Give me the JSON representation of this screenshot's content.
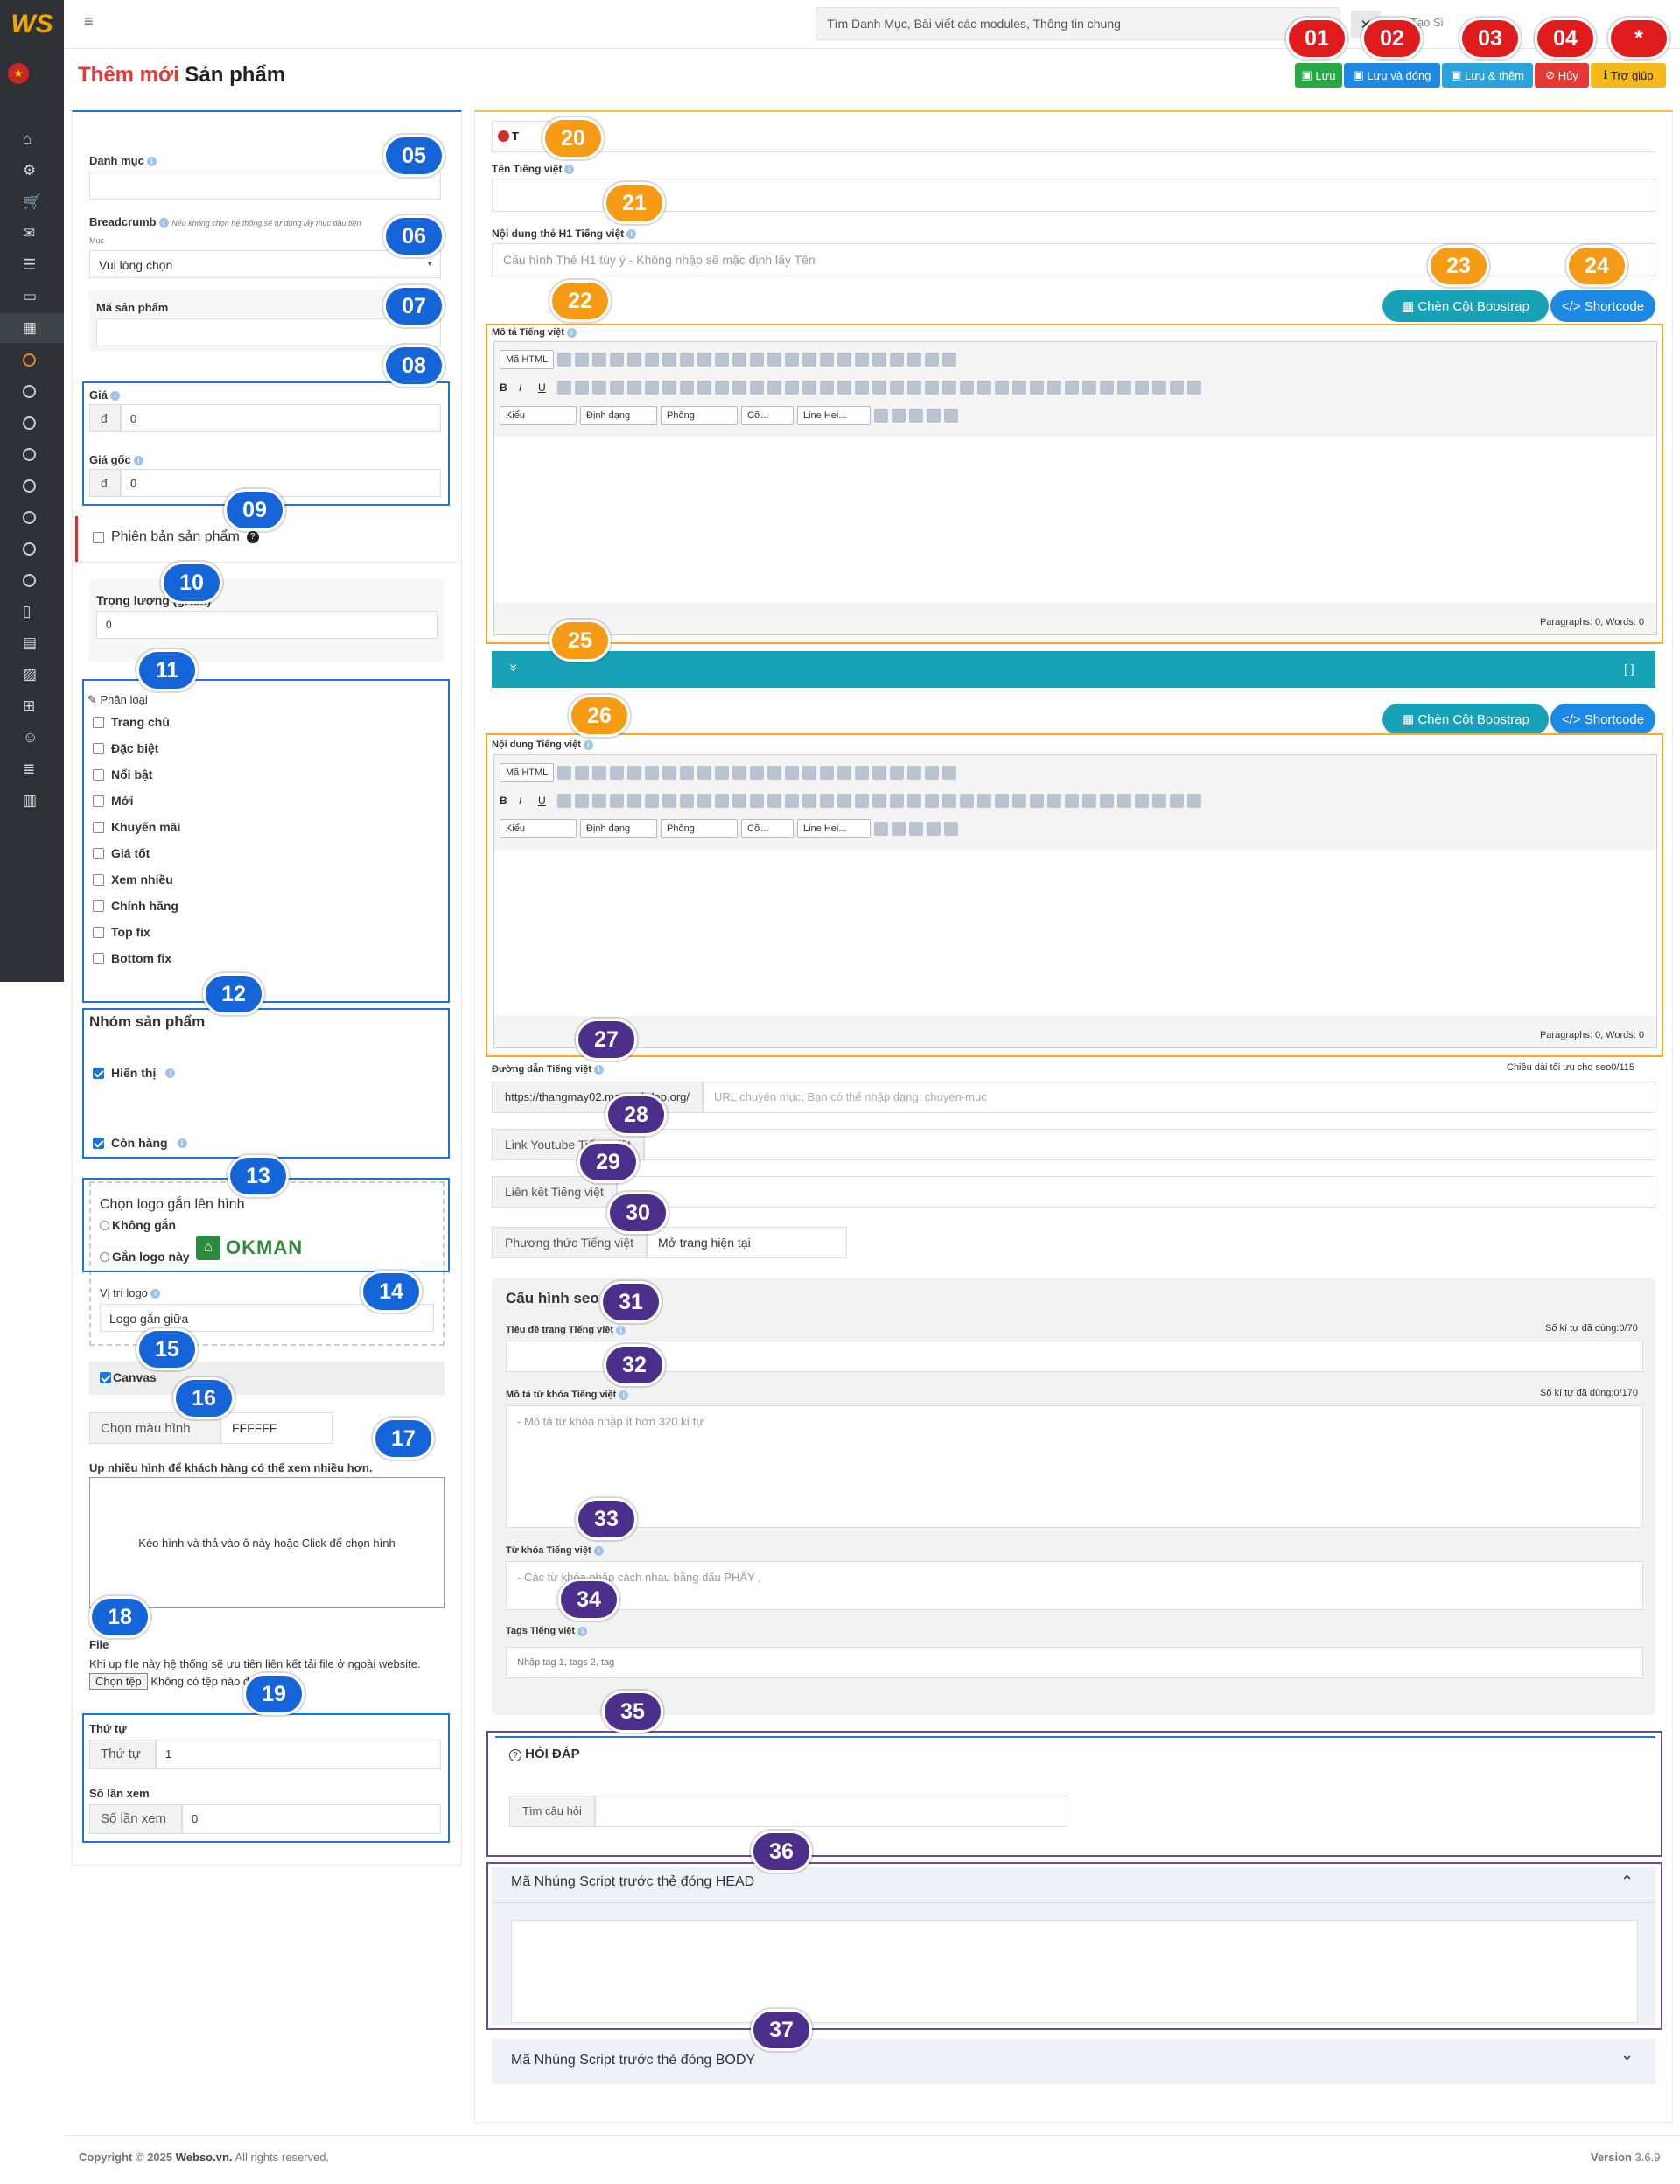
{
  "app": {
    "logo": "WS",
    "hamburger": "≡"
  },
  "topbar": {
    "search_placeholder": "Tìm Danh Mục, Bài viết các modules, Thông tin chung",
    "close": "✕",
    "create_site": "Tạo Si",
    "user": "",
    "settings": ""
  },
  "page_title": {
    "prefix": "Thêm mới",
    "suffix": "Sản phẩm"
  },
  "actions": [
    {
      "label": "Lưu",
      "color": "#28a745"
    },
    {
      "label": "Lưu và đóng",
      "color": "#1e88e5"
    },
    {
      "label": "Lưu & thêm",
      "color": "#29a3d9"
    },
    {
      "label": "Hủy",
      "color": "#e53935"
    },
    {
      "label": "Trợ giúp",
      "color": "#f5b91c"
    }
  ],
  "markers": {
    "m01": "01",
    "m02": "02",
    "m03": "03",
    "m04": "04",
    "m05": "05",
    "m06": "06",
    "m07": "07",
    "m08": "08",
    "m09": "09",
    "m10": "10",
    "m11": "11",
    "m12": "12",
    "m13": "13",
    "m14": "14",
    "m15": "15",
    "m16": "16",
    "m17": "17",
    "m18": "18",
    "m19": "19",
    "m20": "20",
    "m21": "21",
    "m22": "22",
    "m23": "23",
    "m24": "24",
    "m25": "25",
    "m26": "26",
    "m27": "27",
    "m28": "28",
    "m29": "29",
    "m30": "30",
    "m31": "31",
    "m32": "32",
    "m33": "33",
    "m34": "34",
    "m35": "35",
    "m36": "36",
    "m37": "37",
    "help": "*"
  },
  "left": {
    "category_label": "Danh mục",
    "breadcrumb_label": "Breadcrumb",
    "breadcrumb_note": "Nếu không chọn hệ thống sẽ tự động lấy mục đầu tiên",
    "breadcrumb_sub": "Mục",
    "breadcrumb_select": "Vui lòng chọn",
    "sku_label": "Mã sản phẩm",
    "price_label": "Giá",
    "price_currency": "đ",
    "price_value": "0",
    "orig_price_label": "Giá gốc",
    "orig_price_value": "0",
    "variant_label": "Phiên bản sản phẩm",
    "weight_label": "Trọng lượng (gram)",
    "weight_value": "0",
    "classify_label": "Phân loại",
    "classify_items": [
      "Trang chủ",
      "Đặc biệt",
      "Nổi bật",
      "Mới",
      "Khuyến mãi",
      "Giá tốt",
      "Xem nhiều",
      "Chính hãng",
      "Top fix",
      "Bottom fix"
    ],
    "group_label": "Nhóm sản phẩm",
    "show_label": "Hiển thị",
    "stock_label": "Còn hàng",
    "logo_choose_label": "Chọn logo gắn lên hình",
    "logo_none": "Không gắn",
    "logo_attach": "Gắn logo này",
    "logo_brand": "OKMAN",
    "logo_pos_label": "Vị trí logo",
    "logo_pos_value": "Logo gắn giữa",
    "canvas_label": "Canvas",
    "bgcolor_label": "Chọn màu hình",
    "bgcolor_value": "FFFFFF",
    "upload_label": "Up nhiều hình để khách hàng có thể xem nhiều hơn.",
    "upload_drop": "Kéo hình và thả vào ô này hoặc Click để chọn hình",
    "file_label": "File",
    "file_note": "Khi up file này hệ thống sẽ ưu tiên liên kết tải file ở ngoài website.",
    "file_button": "Chọn tệp",
    "file_status": "Không có tệp nào được chọn",
    "order_label": "Thứ tự",
    "order_addon": "Thứ tự",
    "order_value": "1",
    "views_label": "Số lần xem",
    "views_addon": "Số lần xem",
    "views_value": "0"
  },
  "right": {
    "lang_tab": "T",
    "name_label": "Tên Tiếng việt",
    "h1_label": "Nội dung thẻ H1 Tiếng việt",
    "h1_placeholder": "Cấu hình Thẻ H1 tùy ý - Không nhập sẽ mặc định lấy Tên",
    "bootstrap_btn": "Chèn Cột Boostrap",
    "shortcode_btn": "Shortcode",
    "desc_label": "Mô tả Tiếng việt",
    "content_label": "Nội dung Tiếng việt",
    "editor_html": "Mã HTML",
    "editor_drops": [
      "Kiểu",
      "Định dạng",
      "Phông",
      "Cỡ...",
      "Line Hei..."
    ],
    "editor_status": "Paragraphs: 0, Words: 0",
    "collapse_icon": "»",
    "expand_icon": "[ ]",
    "url_label": "Đường dẫn Tiếng việt",
    "url_hint": "Chiều dài tối ưu cho seo0/115",
    "url_prefix": "https://thangmay02.mauwebdep.org/",
    "url_placeholder": "URL chuyên mục, Bạn có thể nhập dạng: chuyen-muc",
    "youtube_addon": "Link Youtube Tiếng việt",
    "link_addon": "Liên kết Tiếng việt",
    "method_addon": "Phương thức Tiếng việt",
    "method_value": "Mở trang hiện tại",
    "seo_title": "Cấu hình seo",
    "seo_page_title": "Tiêu đề trang Tiếng việt",
    "seo_page_count": "Số kí tự đã dùng:0/70",
    "seo_desc_label": "Mô tả từ khóa Tiếng việt",
    "seo_desc_count": "Số kí tự đã dùng:0/170",
    "seo_desc_placeholder": "- Mô tả từ khóa nhập ít hơn 320 kí tự",
    "seo_kw_label": "Từ khóa Tiếng việt",
    "seo_kw_placeholder": "- Các từ khóa nhập cách nhau bằng dấu PHẨY ,",
    "tags_label": "Tags Tiếng việt",
    "tags_placeholder": "Nhập tag 1, tags 2, tag",
    "faq_title": "HỎI ĐÁP",
    "faq_addon": "Tìm câu hỏi",
    "head_script": "Mã Nhúng Script trước thẻ đóng HEAD",
    "body_script": "Mã Nhúng Script trước thẻ đóng BODY"
  },
  "footer": {
    "copyright_pre": "Copyright © 2025",
    "brand": "Webso.vn.",
    "rights": "All rights reserved.",
    "version_label": "Version",
    "version": "3.6.9"
  }
}
